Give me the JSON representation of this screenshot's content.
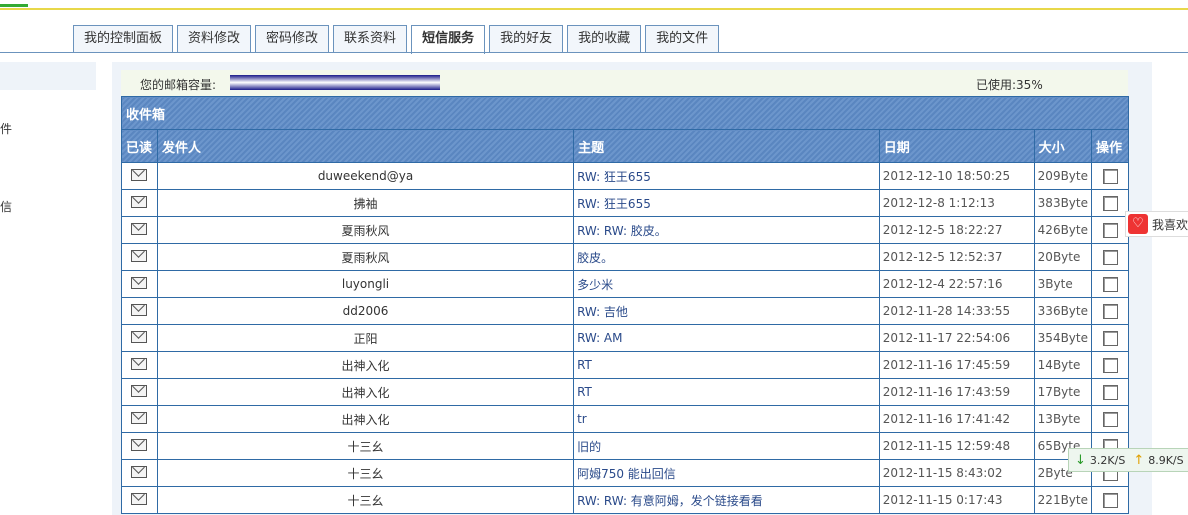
{
  "tabs": [
    "我的控制面板",
    "资料修改",
    "密码修改",
    "联系资料",
    "短信服务",
    "我的好友",
    "我的收藏",
    "我的文件"
  ],
  "active_tab_index": 4,
  "left_panel": {
    "labels": [
      "件",
      "信"
    ]
  },
  "quota": {
    "label": "您的邮箱容量:",
    "used_text": "已使用:35%",
    "used_percent": 35
  },
  "inbox": {
    "caption": "收件箱",
    "columns": {
      "read": "已读",
      "sender": "发件人",
      "subject": "主题",
      "date": "日期",
      "size": "大小",
      "op": "操作"
    },
    "rows": [
      {
        "sender": "duweekend@ya",
        "subject": "RW: 狂王655",
        "date": "2012-12-10 18:50:25",
        "size": "209Byte"
      },
      {
        "sender": "拂袖",
        "subject": "RW: 狂王655",
        "date": "2012-12-8 1:12:13",
        "size": "383Byte"
      },
      {
        "sender": "夏雨秋风",
        "subject": "RW: RW: 胶皮。",
        "date": "2012-12-5 18:22:27",
        "size": "426Byte"
      },
      {
        "sender": "夏雨秋风",
        "subject": "胶皮。",
        "date": "2012-12-5 12:52:37",
        "size": "20Byte"
      },
      {
        "sender": "luyongli",
        "subject": "多少米",
        "date": "2012-12-4 22:57:16",
        "size": "3Byte"
      },
      {
        "sender": "dd2006",
        "subject": "RW: 吉他",
        "date": "2012-11-28 14:33:55",
        "size": "336Byte"
      },
      {
        "sender": "正阳",
        "subject": "RW: AM",
        "date": "2012-11-17 22:54:06",
        "size": "354Byte"
      },
      {
        "sender": "出神入化",
        "subject": "RT",
        "date": "2012-11-16 17:45:59",
        "size": "14Byte"
      },
      {
        "sender": "出神入化",
        "subject": "RT",
        "date": "2012-11-16 17:43:59",
        "size": "17Byte"
      },
      {
        "sender": "出神入化",
        "subject": "tr",
        "date": "2012-11-16 17:41:42",
        "size": "13Byte"
      },
      {
        "sender": "十三幺",
        "subject": "旧的",
        "date": "2012-11-15 12:59:48",
        "size": "65Byte"
      },
      {
        "sender": "十三幺",
        "subject": "阿姆750 能出回信",
        "date": "2012-11-15 8:43:02",
        "size": "2Byte"
      },
      {
        "sender": "十三幺",
        "subject": "RW: RW: 有意阿姆，发个链接看看",
        "date": "2012-11-15 0:17:43",
        "size": "221Byte"
      }
    ]
  },
  "like_widget": {
    "icon": "heart-icon",
    "label": "我喜欢"
  },
  "speed_widget": {
    "down_icon": "download-arrow-icon",
    "down": "3.2K/S",
    "up_icon": "upload-arrow-icon",
    "up": "8.9K/S"
  }
}
